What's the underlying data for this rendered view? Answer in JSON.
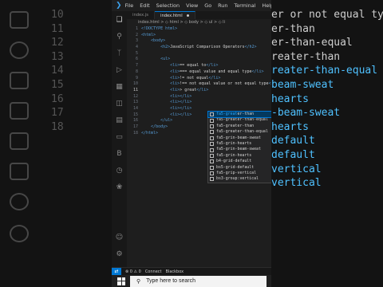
{
  "titlebar": {
    "menus": [
      "File",
      "Edit",
      "Selection",
      "View",
      "Go",
      "Run",
      "Terminal",
      "Help"
    ]
  },
  "tabs": [
    {
      "label": "index.js",
      "active": false
    },
    {
      "label": "index.html",
      "active": true
    }
  ],
  "breadcrumb": "index.html > ◇ html > ◇ body > ◇ ul > ◇ li",
  "code_lines": [
    {
      "n": "1",
      "text": "<!DOCTYPE html>"
    },
    {
      "n": "2",
      "text": "<html>"
    },
    {
      "n": "3",
      "text": "    <body>"
    },
    {
      "n": "4",
      "text": "        <h2>JavaScript Comparison Operators</h2>"
    },
    {
      "n": "5",
      "text": ""
    },
    {
      "n": "6",
      "text": "        <ul>"
    },
    {
      "n": "7",
      "text": "            <li>== equal to</li>"
    },
    {
      "n": "8",
      "text": "            <li>=== equal value and equal type</li>"
    },
    {
      "n": "9",
      "text": "            <li>!= not equal</li>"
    },
    {
      "n": "10",
      "text": "            <li>!== not equal value or not equal type</li>"
    },
    {
      "n": "11",
      "text": "            <li>> great</li>"
    },
    {
      "n": "12",
      "text": "            <li></li>"
    },
    {
      "n": "13",
      "text": "            <li></li>"
    },
    {
      "n": "14",
      "text": "            <li></li>"
    },
    {
      "n": "15",
      "text": "            <li></li>"
    },
    {
      "n": "16",
      "text": "        </ul>"
    },
    {
      "n": "17",
      "text": "    </body>"
    },
    {
      "n": "18",
      "text": "</html>"
    }
  ],
  "current_line": "11",
  "suggestions": [
    {
      "match": "fa5-great",
      "rest": "er-than",
      "selected": true
    },
    {
      "match": "fa5-great",
      "rest": "er-than-equal",
      "selected": false
    },
    {
      "match": "fa5-greater-than",
      "rest": "",
      "selected": false
    },
    {
      "match": "fa5-greater-than-equal",
      "rest": "",
      "selected": false
    },
    {
      "match": "fa5-grin-beam-sweat",
      "rest": "",
      "selected": false
    },
    {
      "match": "fa5-grin-hearts",
      "rest": "",
      "selected": false
    },
    {
      "match": "fa5-grin-beam-sweat",
      "rest": "",
      "selected": false
    },
    {
      "match": "fa5-grin-hearts",
      "rest": "",
      "selected": false
    },
    {
      "match": "b4-grid-default",
      "rest": "",
      "selected": false
    },
    {
      "match": "bs5-grid-default",
      "rest": "",
      "selected": false
    },
    {
      "match": "fa5-grip-vertical",
      "rest": "",
      "selected": false
    },
    {
      "match": "bs3-group:vertical",
      "rest": "",
      "selected": false
    }
  ],
  "statusbar": {
    "errors": "⊗ 0 ⚠ 0",
    "connect": "Connect",
    "blackbox": "Blackbox"
  },
  "taskbar": {
    "search_placeholder": "Type here to search"
  },
  "background": {
    "right_lines": [
      "er or not equal type<",
      "er-than",
      "er-than-equal",
      "reater-than",
      "reater-than-equal",
      "beam-sweat",
      "hearts",
      "-beam-sweat",
      "hearts",
      "default",
      "default",
      "vertical",
      "vertical"
    ],
    "left_numbers": [
      "10",
      "11",
      "12",
      "13",
      "14",
      "15",
      "16",
      "17",
      "18"
    ]
  },
  "colors": {
    "accent": "#0078d4",
    "keyword": "#569cd6",
    "match": "#2aaaff"
  }
}
